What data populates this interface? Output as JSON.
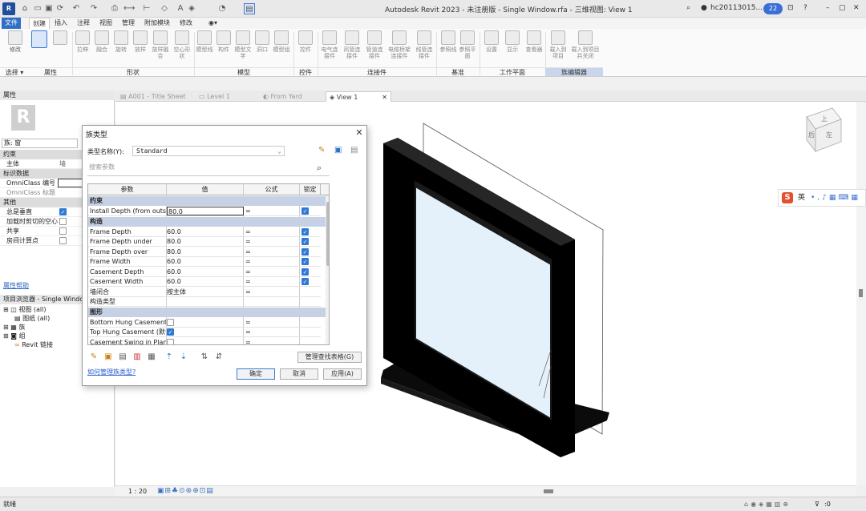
{
  "window": {
    "logo": "R",
    "title": "Autodesk Revit 2023 - 未注册版 - Single Window.rfa - 三维视图: View 1",
    "user": "hc20113015...",
    "notifications": "22"
  },
  "ribbon": {
    "tabs": [
      "文件",
      "创建",
      "插入",
      "注释",
      "视图",
      "管理",
      "附加模块",
      "修改"
    ],
    "active_tab": "创建",
    "buttons": [
      {
        "label": "修改"
      },
      {
        "label": ""
      },
      {
        "label": ""
      },
      {
        "label": "拉伸"
      },
      {
        "label": "融合"
      },
      {
        "label": "旋转"
      },
      {
        "label": "放样"
      },
      {
        "label": "放样融合"
      },
      {
        "label": "空心形状"
      },
      {
        "label": "模型线"
      },
      {
        "label": "构件"
      },
      {
        "label": "模型文字"
      },
      {
        "label": "洞口"
      },
      {
        "label": "模型组"
      },
      {
        "label": "控件"
      },
      {
        "label": "电气连接件"
      },
      {
        "label": "风管连接件"
      },
      {
        "label": "管道连接件"
      },
      {
        "label": "电缆桥架连接件"
      },
      {
        "label": "线管连接件"
      },
      {
        "label": "参照线"
      },
      {
        "label": "参照平面"
      },
      {
        "label": "设置"
      },
      {
        "label": "显示"
      },
      {
        "label": "查看器"
      },
      {
        "label": "载入到项目"
      },
      {
        "label": "载入到项目并关闭"
      }
    ],
    "groups": {
      "select": "选择 ▾",
      "properties": "属性",
      "shape": "形状",
      "model": "模型",
      "control": "控件",
      "connector": "连接件",
      "datum": "基准",
      "workplane": "工作平面",
      "family_editor": "族编辑器"
    }
  },
  "properties": {
    "header": "属性",
    "family_selector": "族: 窗",
    "sections": {
      "constraints": "约束",
      "identity": "标识数据",
      "other": "其他"
    },
    "host_label": "主体",
    "host_value": "墙",
    "omniclass_no": "OmniClass 编号",
    "omniclass_title": "OmniClass 标题",
    "always_vertical": "总是垂直",
    "cut_with_voids": "加载时剪切的空心",
    "shared": "共享",
    "room_calc_point": "房间计算点",
    "help": "属性帮助"
  },
  "browser": {
    "header": "项目浏览器 - Single Window...",
    "items": [
      "视图 (all)",
      "图纸 (all)",
      "族",
      "组",
      "Revit 链接"
    ]
  },
  "views": {
    "tabs": [
      "A001 - Title Sheet",
      "Level 1",
      "From Yard",
      "View 1"
    ],
    "active": "View 1",
    "scale": "1 : 20",
    "viewcube_top": "上",
    "viewcube_left": "后",
    "viewcube_right": "左"
  },
  "status": {
    "text": "就绪",
    "right": ":0"
  },
  "ime": {
    "logo": "S",
    "lang": "英"
  },
  "dialog": {
    "title": "族类型",
    "type_name_label": "类型名称(Y):",
    "type_name_value": "Standard",
    "search_placeholder": "搜索参数",
    "columns": [
      "参数",
      "值",
      "公式",
      "锁定"
    ],
    "groups": [
      {
        "name": "约束",
        "rows": [
          {
            "param": "Install Depth (from outsid",
            "value": "80.0",
            "formula": "=",
            "locked": true,
            "editing": true
          }
        ]
      },
      {
        "name": "构造",
        "rows": [
          {
            "param": "Frame Depth",
            "value": "60.0",
            "formula": "=",
            "locked": true
          },
          {
            "param": "Frame Depth under",
            "value": "80.0",
            "formula": "=",
            "locked": true
          },
          {
            "param": "Frame Depth over",
            "value": "80.0",
            "formula": "=",
            "locked": true
          },
          {
            "param": "Frame Width",
            "value": "60.0",
            "formula": "=",
            "locked": true
          },
          {
            "param": "Casement Depth",
            "value": "60.0",
            "formula": "=",
            "locked": true
          },
          {
            "param": "Casement Width",
            "value": "60.0",
            "formula": "=",
            "locked": true
          },
          {
            "param": "墙闭合",
            "value": "按主体",
            "formula": "=",
            "locked": null
          },
          {
            "param": "构造类型",
            "value": "",
            "formula": "",
            "locked": null
          }
        ]
      },
      {
        "name": "图形",
        "rows": [
          {
            "param": "Bottom Hung Casement (",
            "value": "",
            "checkbox": false,
            "formula": "=",
            "locked": null
          },
          {
            "param": "Top Hung Casement (默认",
            "value": "",
            "checkbox": true,
            "formula": "=",
            "locked": null
          },
          {
            "param": "Casement Swing in Plan (",
            "value": "",
            "checkbox": false,
            "formula": "=",
            "locked": null
          }
        ]
      }
    ],
    "manage_lookup": "管理查找表格(G)",
    "help_link": "如何管理族类型?",
    "ok": "确定",
    "cancel": "取消",
    "apply": "应用(A)"
  }
}
